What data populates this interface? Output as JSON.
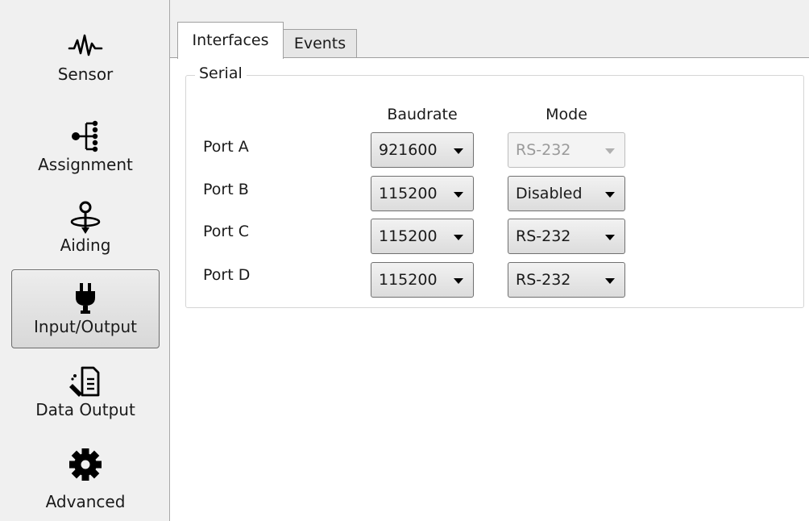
{
  "sidebar": {
    "items": [
      {
        "label": "Sensor",
        "icon": "waveform-icon",
        "active": false
      },
      {
        "label": "Assignment",
        "icon": "tree-icon",
        "active": false
      },
      {
        "label": "Aiding",
        "icon": "location-pin-icon",
        "active": false
      },
      {
        "label": "Input/Output",
        "icon": "plug-icon",
        "active": true
      },
      {
        "label": "Data Output",
        "icon": "document-pen-icon",
        "active": false
      },
      {
        "label": "Advanced",
        "icon": "gear-icon",
        "active": false
      }
    ]
  },
  "tabs": [
    {
      "label": "Interfaces",
      "active": true
    },
    {
      "label": "Events",
      "active": false
    }
  ],
  "serial": {
    "title": "Serial",
    "columns": {
      "baudrate": "Baudrate",
      "mode": "Mode"
    },
    "ports": [
      {
        "label": "Port A",
        "baudrate": "921600",
        "mode": "RS-232",
        "mode_disabled": true
      },
      {
        "label": "Port B",
        "baudrate": "115200",
        "mode": "Disabled",
        "mode_disabled": false
      },
      {
        "label": "Port C",
        "baudrate": "115200",
        "mode": "RS-232",
        "mode_disabled": false
      },
      {
        "label": "Port D",
        "baudrate": "115200",
        "mode": "RS-232",
        "mode_disabled": false
      }
    ]
  }
}
